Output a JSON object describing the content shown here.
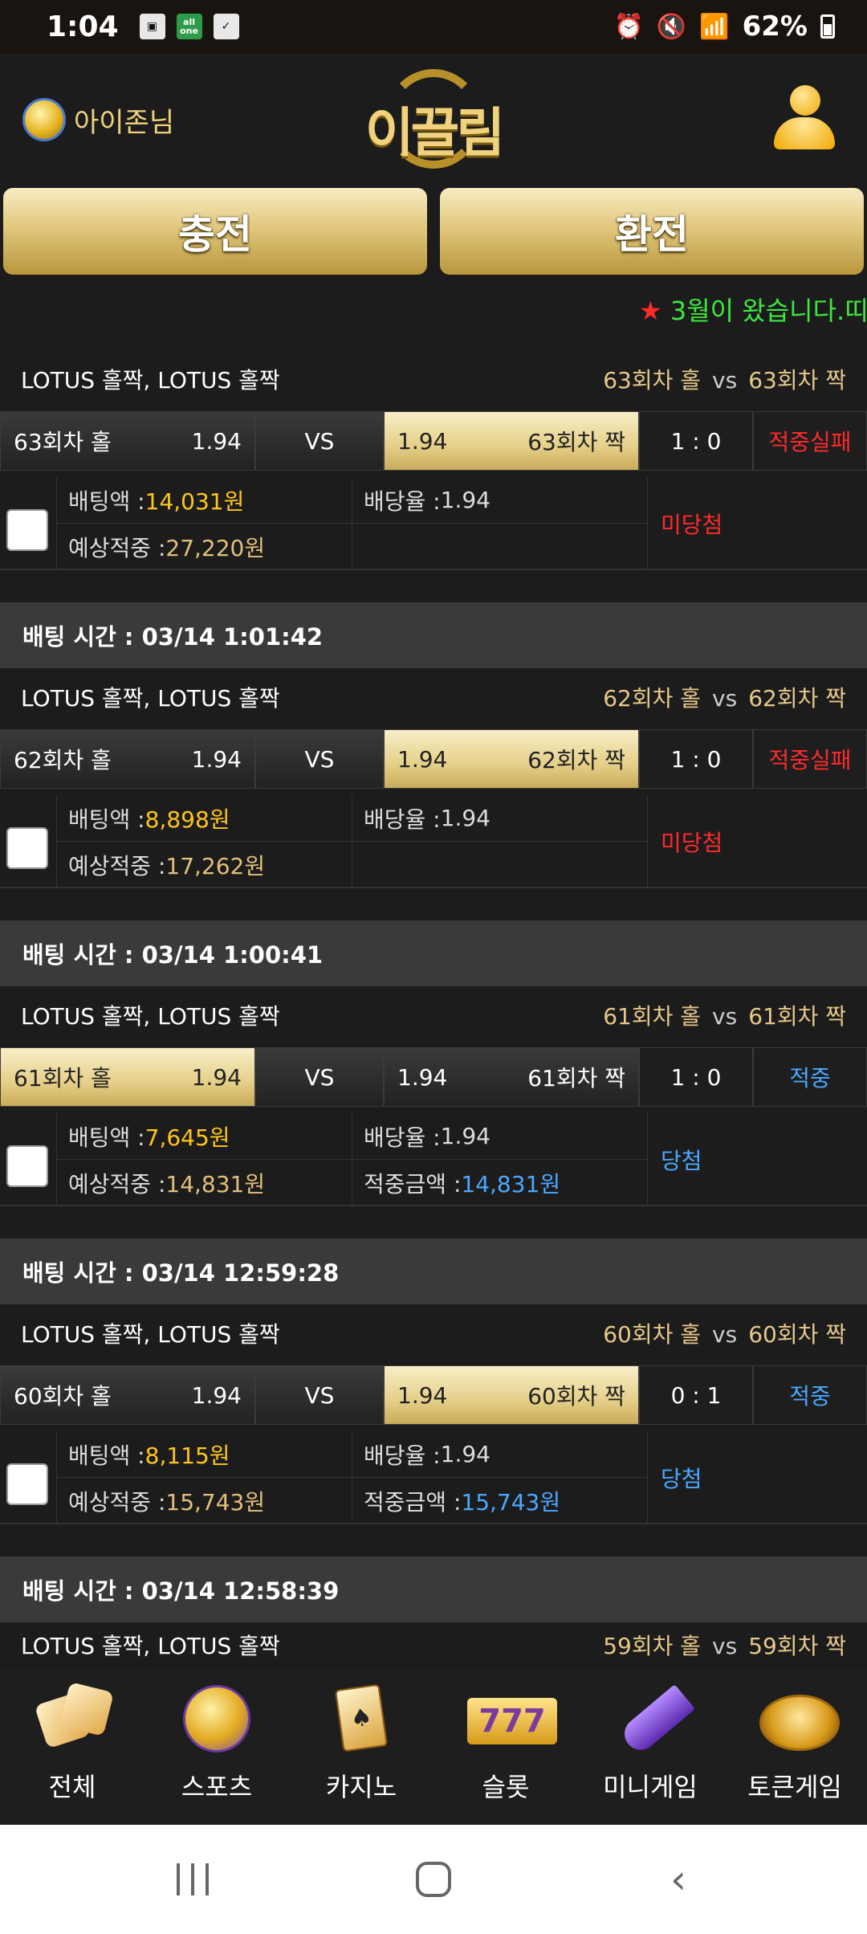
{
  "status_bar": {
    "time": "1:04",
    "battery": "62%"
  },
  "header": {
    "username": "아이존님",
    "logo": "이끌림"
  },
  "buttons": {
    "deposit": "충전",
    "withdraw": "환전"
  },
  "marquee": "3월이 왔습니다.띠",
  "bets": [
    {
      "game": "LOTUS 홀짝, LOTUS 홀짝",
      "match_home": "63회차 홀",
      "match_away": "63회차 짝",
      "home_name": "63회차 홀",
      "home_odds": "1.94",
      "vs": "VS",
      "away_odds": "1.94",
      "away_name": "63회차 짝",
      "selected": "away",
      "score": "1 : 0",
      "result": "적중실패",
      "result_color": "red",
      "bet_label": "배팅액 :",
      "bet_amount": "14,031원",
      "odds_label": "배당율 :",
      "odds": "1.94",
      "expected_label": "예상적중 :",
      "expected": "27,220원",
      "win_label": "",
      "win_amount": "",
      "status": "미당첨",
      "status_color": "red"
    },
    {
      "time": "배팅 시간 : 03/14 1:01:42",
      "game": "LOTUS 홀짝, LOTUS 홀짝",
      "match_home": "62회차 홀",
      "match_away": "62회차 짝",
      "home_name": "62회차 홀",
      "home_odds": "1.94",
      "vs": "VS",
      "away_odds": "1.94",
      "away_name": "62회차 짝",
      "selected": "away",
      "score": "1 : 0",
      "result": "적중실패",
      "result_color": "red",
      "bet_label": "배팅액 :",
      "bet_amount": "8,898원",
      "odds_label": "배당율 :",
      "odds": "1.94",
      "expected_label": "예상적중 :",
      "expected": "17,262원",
      "win_label": "",
      "win_amount": "",
      "status": "미당첨",
      "status_color": "red"
    },
    {
      "time": "배팅 시간 : 03/14 1:00:41",
      "game": "LOTUS 홀짝, LOTUS 홀짝",
      "match_home": "61회차 홀",
      "match_away": "61회차 짝",
      "home_name": "61회차 홀",
      "home_odds": "1.94",
      "vs": "VS",
      "away_odds": "1.94",
      "away_name": "61회차 짝",
      "selected": "home",
      "score": "1 : 0",
      "result": "적중",
      "result_color": "blue",
      "bet_label": "배팅액 :",
      "bet_amount": "7,645원",
      "odds_label": "배당율 :",
      "odds": "1.94",
      "expected_label": "예상적중 :",
      "expected": "14,831원",
      "win_label": "적중금액 :",
      "win_amount": "14,831원",
      "status": "당첨",
      "status_color": "blue"
    },
    {
      "time": "배팅 시간 : 03/14 12:59:28",
      "game": "LOTUS 홀짝, LOTUS 홀짝",
      "match_home": "60회차 홀",
      "match_away": "60회차 짝",
      "home_name": "60회차 홀",
      "home_odds": "1.94",
      "vs": "VS",
      "away_odds": "1.94",
      "away_name": "60회차 짝",
      "selected": "away",
      "score": "0 : 1",
      "result": "적중",
      "result_color": "blue",
      "bet_label": "배팅액 :",
      "bet_amount": "8,115원",
      "odds_label": "배당율 :",
      "odds": "1.94",
      "expected_label": "예상적중 :",
      "expected": "15,743원",
      "win_label": "적중금액 :",
      "win_amount": "15,743원",
      "status": "당첨",
      "status_color": "blue"
    },
    {
      "time": "배팅 시간 : 03/14 12:58:39",
      "game": "LOTUS 홀짝, LOTUS 홀짝",
      "match_home": "59회차 홀",
      "match_away": "59회차 짝"
    }
  ],
  "vs_word": "vs",
  "nav": [
    {
      "label": "전체",
      "icon": "dice-icon"
    },
    {
      "label": "스포츠",
      "icon": "soccer-ball-icon"
    },
    {
      "label": "카지노",
      "icon": "playing-cards-icon"
    },
    {
      "label": "슬롯",
      "icon": "slot-777-icon"
    },
    {
      "label": "미니게임",
      "icon": "rocket-icon"
    },
    {
      "label": "토큰게임",
      "icon": "roulette-icon"
    }
  ],
  "slot_text": "777",
  "colors": {
    "gold": "#e2c87e",
    "red": "#ff2a2a",
    "blue": "#4aa8ff",
    "marquee": "#3ee83e"
  }
}
